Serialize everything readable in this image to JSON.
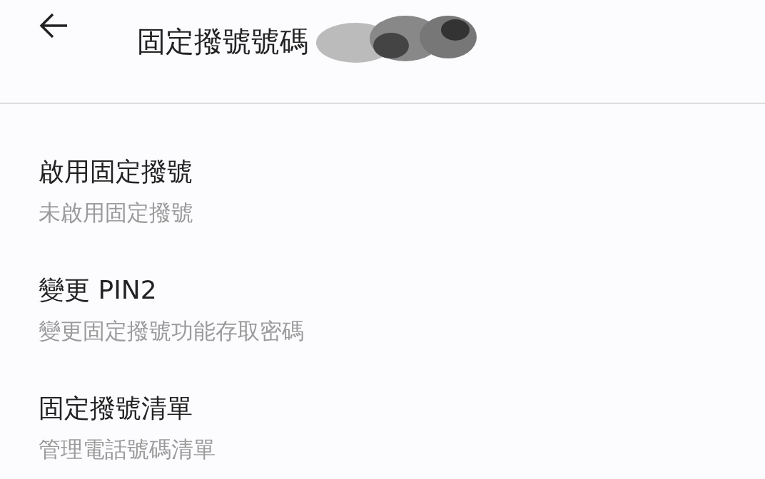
{
  "header": {
    "title": "固定撥號號碼"
  },
  "items": [
    {
      "title": "啟用固定撥號",
      "summary": "未啟用固定撥號"
    },
    {
      "title": "變更 PIN2",
      "summary": "變更固定撥號功能存取密碼"
    },
    {
      "title": "固定撥號清單",
      "summary": "管理電話號碼清單"
    }
  ]
}
